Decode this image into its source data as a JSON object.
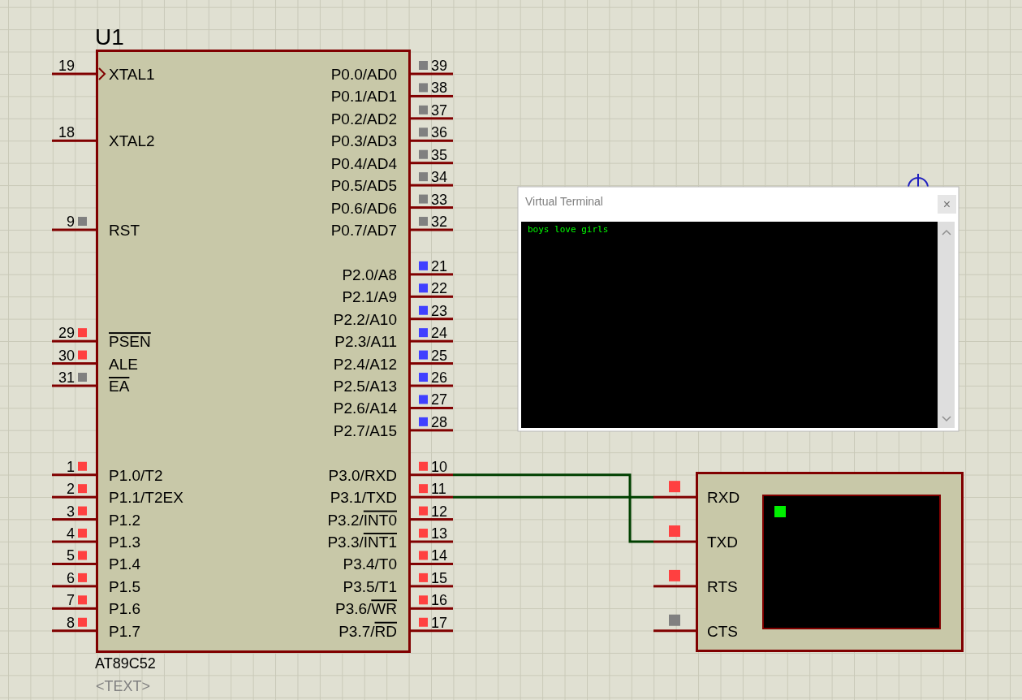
{
  "chip": {
    "ref": "U1",
    "part": "AT89C52",
    "text_field": "<TEXT>",
    "left_pins": [
      {
        "number": "19",
        "label": "XTAL1",
        "clock": true
      },
      {
        "number": "18",
        "label": "XTAL2",
        "clock": false
      },
      {
        "number": "9",
        "label": "RST",
        "clock": false,
        "color": "#808080"
      },
      {
        "number": "29",
        "overbar": "PSEN",
        "clock": false,
        "color": "#ff4040"
      },
      {
        "number": "30",
        "label": "ALE",
        "clock": false,
        "color": "#ff4040"
      },
      {
        "number": "31",
        "overbar": "EA",
        "clock": false,
        "color": "#808080"
      },
      {
        "number": "1",
        "label": "P1.0/T2",
        "clock": false,
        "color": "#ff4040"
      },
      {
        "number": "2",
        "label": "P1.1/T2EX",
        "clock": false,
        "color": "#ff4040"
      },
      {
        "number": "3",
        "label": "P1.2",
        "clock": false,
        "color": "#ff4040"
      },
      {
        "number": "4",
        "label": "P1.3",
        "clock": false,
        "color": "#ff4040"
      },
      {
        "number": "5",
        "label": "P1.4",
        "clock": false,
        "color": "#ff4040"
      },
      {
        "number": "6",
        "label": "P1.5",
        "clock": false,
        "color": "#ff4040"
      },
      {
        "number": "7",
        "label": "P1.6",
        "clock": false,
        "color": "#ff4040"
      },
      {
        "number": "8",
        "label": "P1.7",
        "clock": false,
        "color": "#ff4040"
      }
    ],
    "right_pins": [
      {
        "number": "39",
        "label": "P0.0/AD0",
        "color": "#808080"
      },
      {
        "number": "38",
        "label": "P0.1/AD1",
        "color": "#808080"
      },
      {
        "number": "37",
        "label": "P0.2/AD2",
        "color": "#808080"
      },
      {
        "number": "36",
        "label": "P0.3/AD3",
        "color": "#808080"
      },
      {
        "number": "35",
        "label": "P0.4/AD4",
        "color": "#808080"
      },
      {
        "number": "34",
        "label": "P0.5/AD5",
        "color": "#808080"
      },
      {
        "number": "33",
        "label": "P0.6/AD6",
        "color": "#808080"
      },
      {
        "number": "32",
        "label": "P0.7/AD7",
        "color": "#808080"
      },
      {
        "number": "21",
        "label": "P2.0/A8",
        "color": "#4040ff"
      },
      {
        "number": "22",
        "label": "P2.1/A9",
        "color": "#4040ff"
      },
      {
        "number": "23",
        "label": "P2.2/A10",
        "color": "#4040ff"
      },
      {
        "number": "24",
        "label": "P2.3/A11",
        "color": "#4040ff"
      },
      {
        "number": "25",
        "label": "P2.4/A12",
        "color": "#4040ff"
      },
      {
        "number": "26",
        "label": "P2.5/A13",
        "color": "#4040ff"
      },
      {
        "number": "27",
        "label": "P2.6/A14",
        "color": "#4040ff"
      },
      {
        "number": "28",
        "label": "P2.7/A15",
        "color": "#4040ff"
      },
      {
        "number": "10",
        "label": "P3.0/RXD",
        "color": "#ff4040"
      },
      {
        "number": "11",
        "label": "P3.1/TXD",
        "color": "#ff4040"
      },
      {
        "number": "12",
        "label": "P3.2/",
        "overbar": "INT0",
        "color": "#ff4040"
      },
      {
        "number": "13",
        "label": "P3.3/",
        "overbar": "INT1",
        "color": "#ff4040"
      },
      {
        "number": "14",
        "label": "P3.4/T0",
        "color": "#ff4040"
      },
      {
        "number": "15",
        "label": "P3.5/T1",
        "color": "#ff4040"
      },
      {
        "number": "16",
        "label": "P3.6/",
        "overbar": "WR",
        "color": "#ff4040"
      },
      {
        "number": "17",
        "label": "P3.7/",
        "overbar": "RD",
        "color": "#ff4040"
      }
    ]
  },
  "terminal_part": {
    "pins": [
      {
        "label": "RXD",
        "color": "#ff4040"
      },
      {
        "label": "TXD",
        "color": "#ff4040"
      },
      {
        "label": "RTS",
        "color": "#ff4040"
      },
      {
        "label": "CTS",
        "color": "#808080"
      }
    ]
  },
  "terminal_window": {
    "title": "Virtual Terminal",
    "close_button": "×",
    "lines": [
      "boys love girls"
    ]
  }
}
